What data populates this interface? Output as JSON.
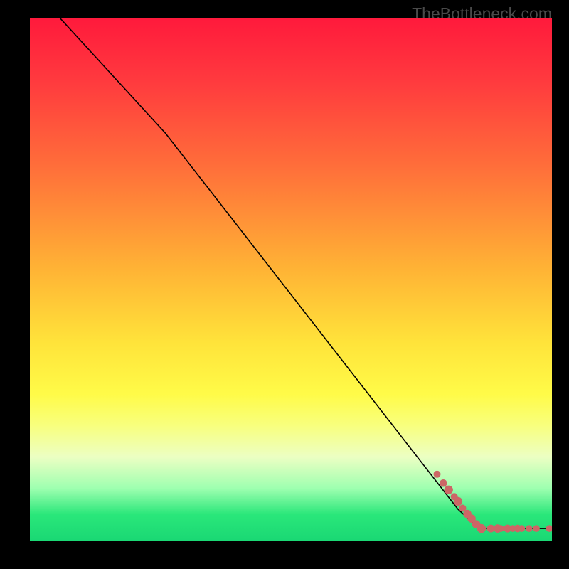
{
  "watermark": "TheBottleneck.com",
  "chart_data": {
    "type": "line",
    "title": "",
    "xlabel": "",
    "ylabel": "",
    "xlim": [
      0,
      100
    ],
    "ylim": [
      0,
      100
    ],
    "curve": [
      {
        "x": 4,
        "y": 102
      },
      {
        "x": 26,
        "y": 78
      },
      {
        "x": 82,
        "y": 6
      },
      {
        "x": 86,
        "y": 2.3
      },
      {
        "x": 100,
        "y": 2.3
      }
    ],
    "points": [
      {
        "x": 78,
        "y": 12.7,
        "r": 1.05
      },
      {
        "x": 79.2,
        "y": 11.0,
        "r": 1.1
      },
      {
        "x": 80.2,
        "y": 9.7,
        "r": 1.3
      },
      {
        "x": 81.3,
        "y": 8.4,
        "r": 1.05
      },
      {
        "x": 82.0,
        "y": 7.5,
        "r": 1.3
      },
      {
        "x": 82.9,
        "y": 6.2,
        "r": 1.05
      },
      {
        "x": 83.8,
        "y": 5.1,
        "r": 1.2
      },
      {
        "x": 84.6,
        "y": 4.2,
        "r": 1.2
      },
      {
        "x": 85.5,
        "y": 3.1,
        "r": 1.2
      },
      {
        "x": 86.5,
        "y": 2.3,
        "r": 1.3
      },
      {
        "x": 88.3,
        "y": 2.3,
        "r": 1.15
      },
      {
        "x": 89.6,
        "y": 2.3,
        "r": 1.2
      },
      {
        "x": 90.2,
        "y": 2.3,
        "r": 1.0
      },
      {
        "x": 91.5,
        "y": 2.3,
        "r": 1.15
      },
      {
        "x": 92.5,
        "y": 2.3,
        "r": 1.0
      },
      {
        "x": 93.4,
        "y": 2.3,
        "r": 1.1
      },
      {
        "x": 94.2,
        "y": 2.3,
        "r": 1.0
      },
      {
        "x": 95.6,
        "y": 2.3,
        "r": 1.0
      },
      {
        "x": 97.0,
        "y": 2.3,
        "r": 1.0
      },
      {
        "x": 99.5,
        "y": 2.3,
        "r": 1.0
      }
    ]
  },
  "colors": {
    "dot": "#cc6666",
    "curve": "#000000"
  }
}
